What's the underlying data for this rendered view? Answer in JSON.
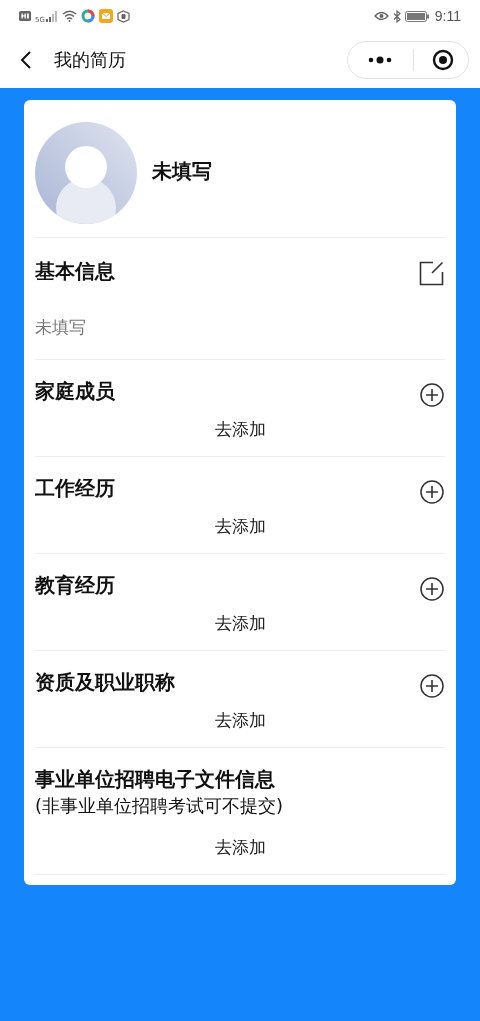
{
  "status_bar": {
    "network": "5G",
    "time": "9:11"
  },
  "nav": {
    "title": "我的简历"
  },
  "profile": {
    "name": "未填写"
  },
  "sections": [
    {
      "kind": "edit",
      "title": "基本信息",
      "value": "未填写"
    },
    {
      "kind": "add",
      "title": "家庭成员",
      "action": "去添加"
    },
    {
      "kind": "add",
      "title": "工作经历",
      "action": "去添加"
    },
    {
      "kind": "add",
      "title": "教育经历",
      "action": "去添加"
    },
    {
      "kind": "add",
      "title": "资质及职业职称",
      "action": "去添加"
    },
    {
      "kind": "plain",
      "title": "事业单位招聘电子文件信息",
      "subtitle": "(非事业单位招聘考试可不提交)",
      "action": "去添加"
    }
  ]
}
